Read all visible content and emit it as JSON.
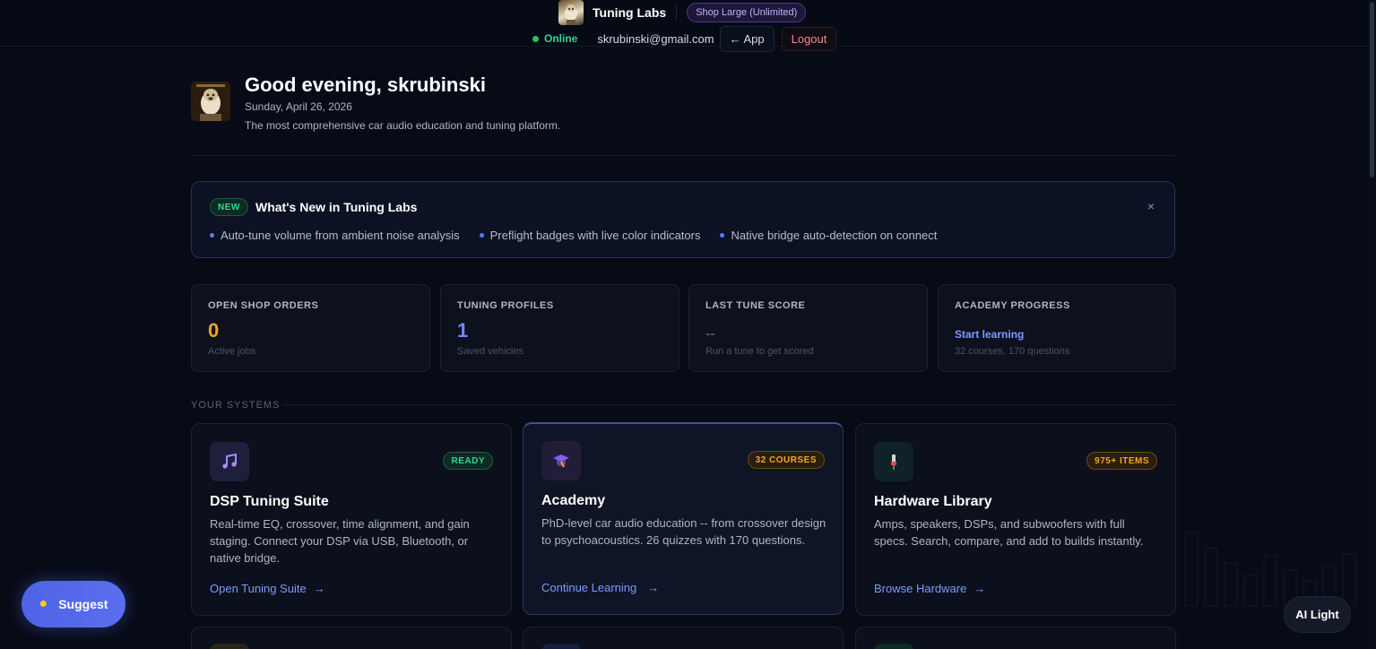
{
  "header": {
    "app_name": "Tuning Labs",
    "plan_badge": "Shop Large (Unlimited)",
    "status": "Online",
    "email": "skrubinski@gmail.com",
    "app_button": "← App",
    "logout_button": "Logout"
  },
  "greeting": {
    "title": "Good evening, skrubinski",
    "date": "Sunday, April 26, 2026",
    "subtitle": "The most comprehensive car audio education and tuning platform."
  },
  "whats_new": {
    "badge": "NEW",
    "title": "What's New in Tuning Labs",
    "close": "×",
    "items": [
      "Auto-tune volume from ambient noise analysis",
      "Preflight badges with live color indicators",
      "Native bridge auto-detection on connect"
    ]
  },
  "stats": [
    {
      "label": "OPEN SHOP ORDERS",
      "value": "0",
      "note": "Active jobs",
      "color": "#f5a524"
    },
    {
      "label": "TUNING PROFILES",
      "value": "1",
      "note": "Saved vehicles",
      "color": "#6b8cff"
    },
    {
      "label": "LAST TUNE SCORE",
      "value": "--",
      "note": "Run a tune to get scored",
      "color": "#4b5468"
    },
    {
      "label": "ACADEMY PROGRESS",
      "link": "Start learning",
      "note": "32 courses, 170 questions",
      "color": "#7c9bff"
    }
  ],
  "systems_section": {
    "label": "YOUR SYSTEMS",
    "cards": [
      {
        "icon": "music-note-icon",
        "badge": "READY",
        "title": "DSP Tuning Suite",
        "description": "Real-time EQ, crossover, time alignment, and gain staging. Connect your DSP via USB, Bluetooth, or native bridge.",
        "link": "Open Tuning Suite",
        "arrow": "→"
      },
      {
        "icon": "graduation-cap-icon",
        "badge": "32 COURSES",
        "title": "Academy",
        "description": "PhD-level car audio education -- from crossover design to psychoacoustics. 26 quizzes with 170 questions.",
        "link": "Continue Learning",
        "arrow": "→"
      },
      {
        "icon": "audio-jack-icon",
        "badge": "975+ ITEMS",
        "title": "Hardware Library",
        "description": "Amps, speakers, DSPs, and subwoofers with full specs. Search, compare, and add to builds instantly.",
        "link": "Browse Hardware",
        "arrow": "→"
      }
    ]
  },
  "floating": {
    "suggest": "Suggest",
    "ai_light": "AI Light"
  }
}
